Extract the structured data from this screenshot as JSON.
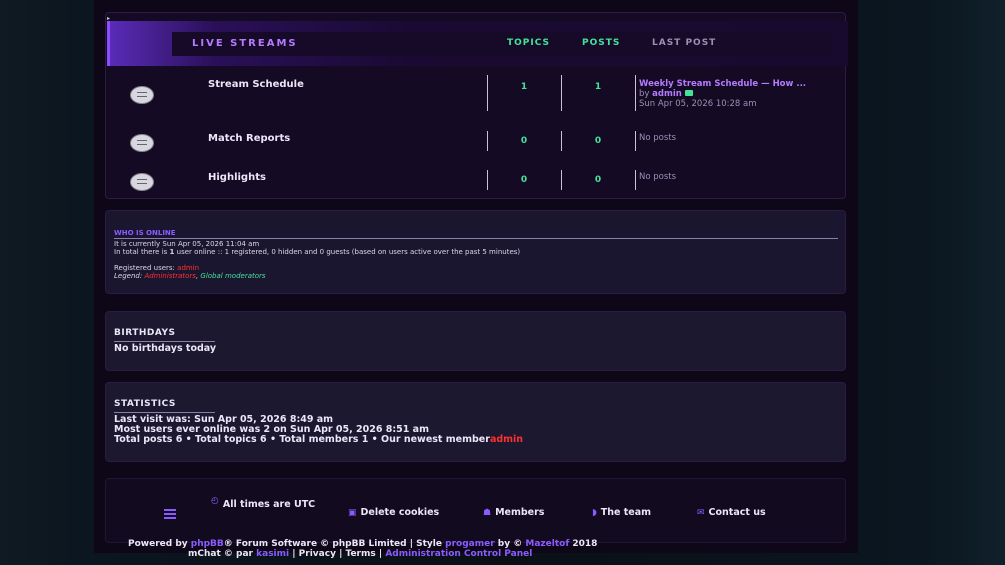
{
  "forum": {
    "header": {
      "title": "LIVE STREAMS",
      "col_topics": "TOPICS",
      "col_posts": "POSTS",
      "col_last_post": "LAST POST"
    },
    "rows": [
      {
        "name": "Stream Schedule",
        "topics": "1",
        "posts": "1",
        "last_post_title": "Weekly Stream Schedule — How ...",
        "last_post_by": "by",
        "last_post_author": "admin",
        "last_post_time": "Sun Apr 05, 2026 10:28 am"
      },
      {
        "name": "Match Reports",
        "topics": "0",
        "posts": "0",
        "last_post_empty": "No posts"
      },
      {
        "name": "Highlights",
        "topics": "0",
        "posts": "0",
        "last_post_empty": "No posts"
      }
    ]
  },
  "who_online": {
    "title": "WHO IS ONLINE",
    "current_time": "It is currently Sun Apr 05, 2026 11:04 am",
    "total_prefix": "In total there is",
    "total_count": "1",
    "total_suffix": "user online :: 1 registered, 0 hidden and 0 guests (based on users active over the past 5 minutes)",
    "registered_label": "Registered users:",
    "registered_user": "admin",
    "legend_label": "Legend:",
    "legend_admins": "Administrators",
    "legend_sep": ",",
    "legend_mods": "Global moderators"
  },
  "birthdays": {
    "title": "BIRTHDAYS",
    "text": "No birthdays today"
  },
  "statistics": {
    "title": "STATISTICS",
    "last_visit": "Last visit was: Sun Apr 05, 2026 8:49 am",
    "most_online": "Most users ever online was 2 on Sun Apr 05, 2026 8:51 am",
    "totals": "Total posts 6 • Total topics 6 • Total members 1 • Our newest member",
    "newest_member": "admin"
  },
  "footer": {
    "timezone": "All times are UTC",
    "delete_cookies": "Delete cookies",
    "members": "Members",
    "team": "The team",
    "contact": "Contact us",
    "powered_prefix": "Powered by",
    "phpbb": "phpBB",
    "powered_mid": "® Forum Software © phpBB Limited | Style",
    "style_name": "progamer",
    "by_text": "by ©",
    "author": "Mazeltof",
    "year": "2018",
    "mchat_prefix": "mChat © par",
    "mchat_author": "kasimi",
    "privacy": "| Privacy |",
    "terms": "Terms",
    "sep": "|",
    "acp": "Administration Control Panel"
  },
  "colors": {
    "accent_purple": "#8a5cff",
    "count_green": "#43e39a",
    "admin_red": "#ff3030",
    "bg_dark": "#0d0717"
  }
}
